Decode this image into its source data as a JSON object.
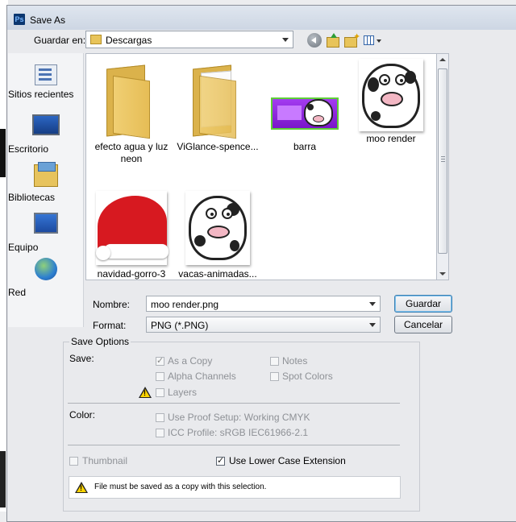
{
  "window": {
    "title": "Save As",
    "app_icon": "Ps"
  },
  "nav": {
    "save_in_label": "Guardar en:",
    "location": "Descargas",
    "toolbar_icons": [
      "back-icon",
      "up-folder-icon",
      "new-folder-icon",
      "view-menu-icon"
    ]
  },
  "places": [
    {
      "label": "Sitios recientes",
      "icon": "recent-places-icon"
    },
    {
      "label": "Escritorio",
      "icon": "desktop-icon"
    },
    {
      "label": "Bibliotecas",
      "icon": "libraries-icon"
    },
    {
      "label": "Equipo",
      "icon": "computer-icon"
    },
    {
      "label": "Red",
      "icon": "network-icon"
    }
  ],
  "files": [
    {
      "name": "efecto agua y luz neon",
      "type": "folder"
    },
    {
      "name": "ViGlance-spence...",
      "type": "folder"
    },
    {
      "name": "barra",
      "type": "image"
    },
    {
      "name": "moo render",
      "type": "image"
    },
    {
      "name": "navidad-gorro-3",
      "type": "image"
    },
    {
      "name": "vacas-animadas...",
      "type": "image"
    }
  ],
  "form": {
    "name_label": "Nombre:",
    "name_value": "moo render.png",
    "format_label": "Format:",
    "format_value": "PNG (*.PNG)",
    "save_button": "Guardar",
    "cancel_button": "Cancelar"
  },
  "save_options": {
    "legend": "Save Options",
    "save_label": "Save:",
    "as_a_copy": {
      "label": "As a Copy",
      "checked": true
    },
    "alpha_channels": {
      "label": "Alpha Channels",
      "checked": false
    },
    "layers": {
      "label": "Layers",
      "checked": false
    },
    "notes": {
      "label": "Notes",
      "checked": false
    },
    "spot_colors": {
      "label": "Spot Colors",
      "checked": false
    },
    "color_label": "Color:",
    "proof_setup": {
      "label": "Use Proof Setup:  Working CMYK",
      "checked": false
    },
    "icc_profile": {
      "label": "ICC Profile:  sRGB IEC61966-2.1",
      "checked": false
    },
    "thumbnail": {
      "label": "Thumbnail",
      "checked": false
    },
    "lower_case": {
      "label": "Use Lower Case Extension",
      "checked": true
    },
    "warning_message": "File must be saved as a copy with this selection."
  }
}
